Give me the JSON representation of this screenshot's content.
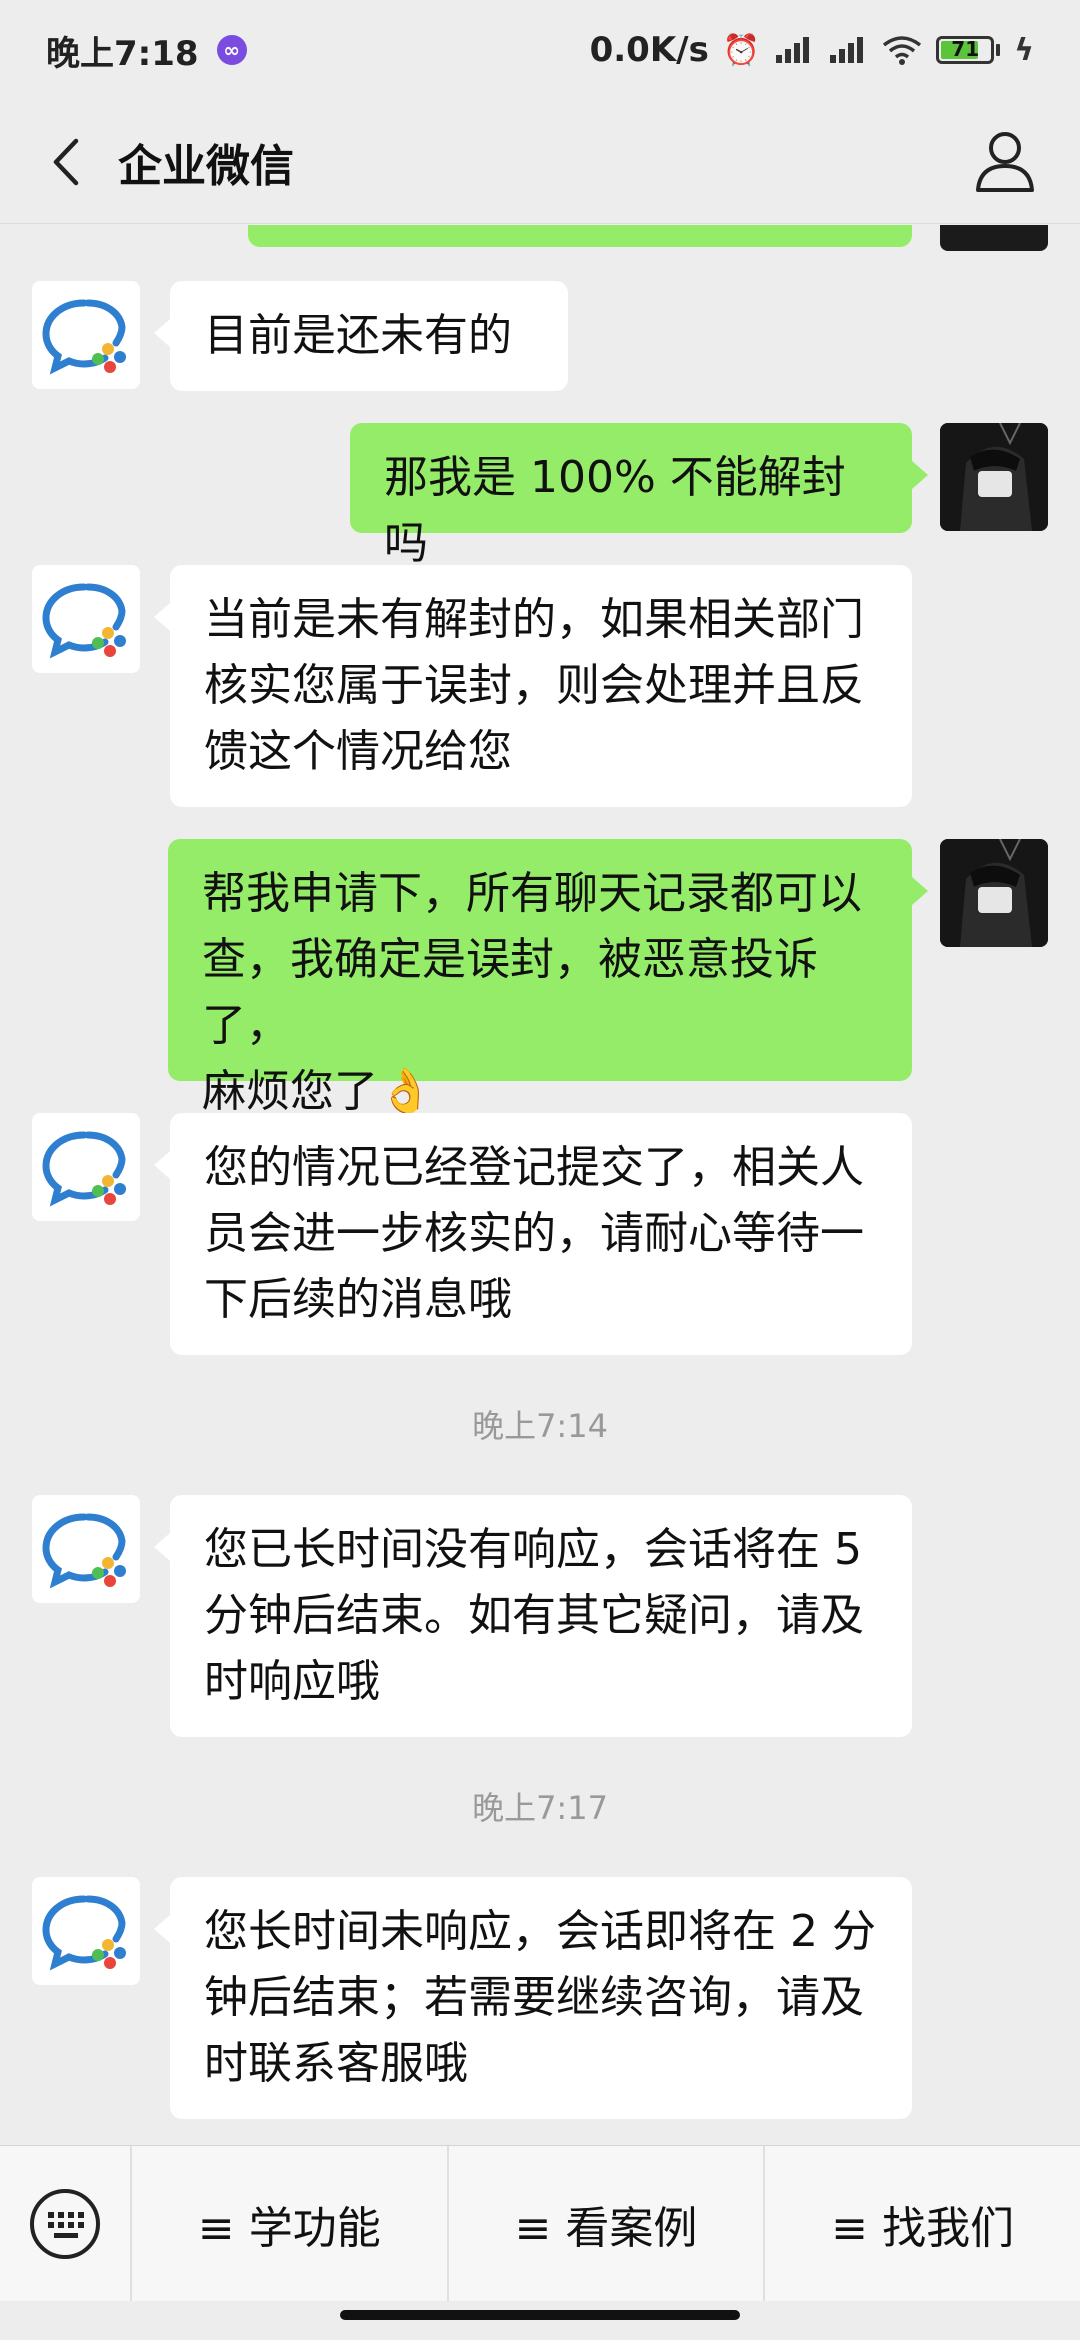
{
  "status_bar": {
    "time": "晚上7:18",
    "network_speed": "0.0K/s",
    "battery": "71"
  },
  "nav": {
    "title": "企业微信"
  },
  "messages": {
    "m1": "目前是还未有的",
    "m2": "那我是 100% 不能解封吗",
    "m3_l1": "当前是未有解封的，如果相关部门",
    "m3_l2": "核实您属于误封，则会处理并且反",
    "m3_l3": "馈这个情况给您",
    "m4_l1": "帮我申请下，所有聊天记录都可以",
    "m4_l2": "查，我确定是误封，被恶意投诉了，",
    "m4_l3": "麻烦您了",
    "m4_emoji": "👌",
    "m5_l1": "您的情况已经登记提交了，相关人",
    "m5_l2": "员会进一步核实的，请耐心等待一",
    "m5_l3": "下后续的消息哦",
    "ts1": "晚上7:14",
    "m6_l1": "您已长时间没有响应，会话将在 5",
    "m6_l2": "分钟后结束。如有其它疑问，请及",
    "m6_l3": "时响应哦",
    "ts2": "晚上7:17",
    "m7_l1": "您长时间未响应，会话即将在 2 分",
    "m7_l2": "钟后结束；若需要继续咨询，请及",
    "m7_l3": "时联系客服哦"
  },
  "bottom_menu": {
    "item1": "≡ 学功能",
    "item2": "≡ 看案例",
    "item3": "≡ 找我们"
  },
  "colors": {
    "user_bubble": "#95ec69",
    "bot_bubble": "#ffffff",
    "background": "#ededed"
  }
}
